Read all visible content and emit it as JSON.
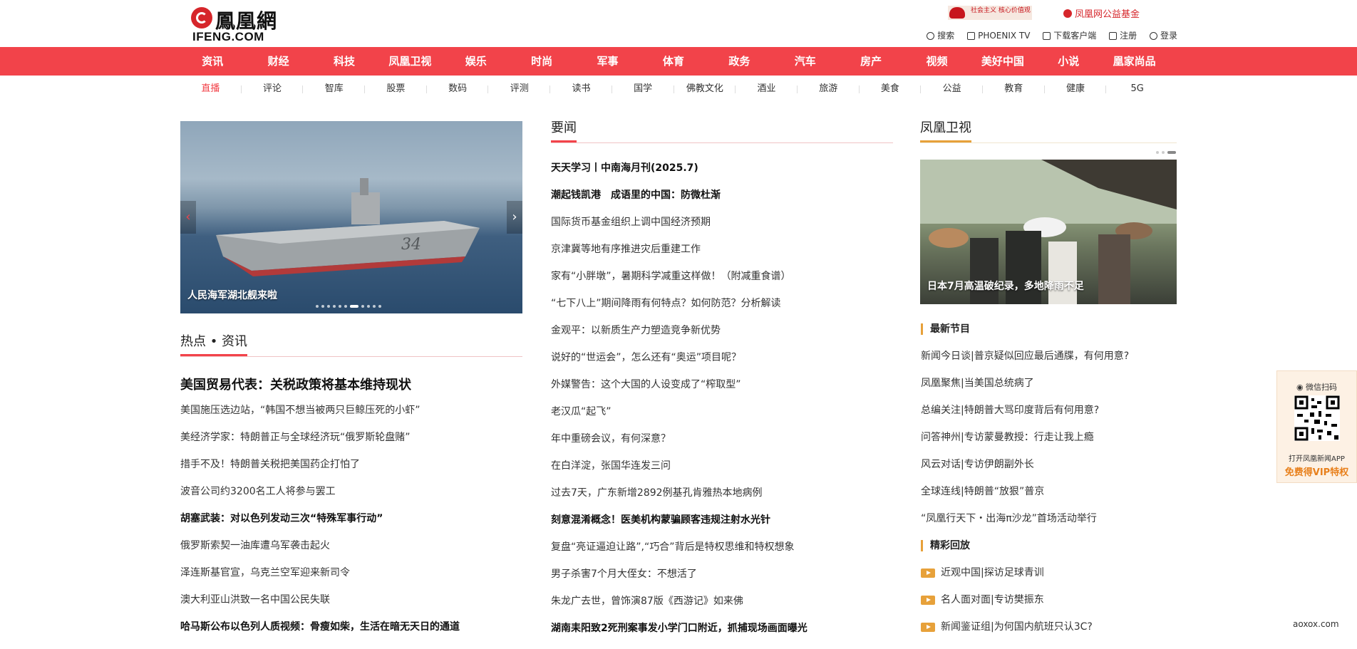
{
  "header": {
    "logo_cn": "鳳凰網",
    "logo_en": "IFENG.COM",
    "promo_left": "社会主义 核心价值观",
    "promo_right": "凤凰网公益基金",
    "top_links": [
      "搜索",
      "PHOENIX TV",
      "下载客户端",
      "注册",
      "登录"
    ]
  },
  "main_nav": [
    "资讯",
    "财经",
    "科技",
    "凤凰卫视",
    "娱乐",
    "时尚",
    "军事",
    "体育",
    "政务",
    "汽车",
    "房产",
    "视频",
    "美好中国",
    "小说",
    "凰家尚品"
  ],
  "sub_nav": [
    "直播",
    "评论",
    "智库",
    "股票",
    "数码",
    "评测",
    "读书",
    "国学",
    "佛教文化",
    "酒业",
    "旅游",
    "美食",
    "公益",
    "教育",
    "健康",
    "5G"
  ],
  "carousel": {
    "caption": "人民海军湖北舰来啦",
    "slide_count": 11,
    "active_index": 6
  },
  "hot": {
    "title": "热点 • 资讯",
    "lead": "美国贸易代表：关税政策将基本维持现状",
    "items": [
      {
        "text": "美国施压选边站，“韩国不想当被两只巨鲸压死的小虾”",
        "bold": false
      },
      {
        "text": "美经济学家：特朗普正与全球经济玩“俄罗斯轮盘赌”",
        "bold": false
      },
      {
        "text": "措手不及！特朗普关税把美国药企打怕了",
        "bold": false
      },
      {
        "text": "波音公司约3200名工人将参与罢工",
        "bold": false
      },
      {
        "text": "胡塞武装：对以色列发动三次“特殊军事行动”",
        "bold": true
      },
      {
        "text": "俄罗斯索契一油库遭乌军袭击起火",
        "bold": false
      },
      {
        "text": "泽连斯基官宣，乌克兰空军迎来新司令",
        "bold": false
      },
      {
        "text": "澳大利亚山洪致一名中国公民失联",
        "bold": false
      },
      {
        "text": "哈马斯公布以色列人质视频：骨瘦如柴，生活在暗无天日的通道",
        "bold": true
      }
    ]
  },
  "news": {
    "title": "要闻",
    "items": [
      {
        "text": "天天学习丨中南海月刊(2025.7)",
        "bold": true
      },
      {
        "text": "潮起钱凯港　成语里的中国：防微杜渐",
        "bold": true
      },
      {
        "text": "国际货币基金组织上调中国经济预期",
        "bold": false
      },
      {
        "text": "京津冀等地有序推进灾后重建工作",
        "bold": false
      },
      {
        "text": "家有“小胖墩”，暑期科学减重这样做！（附减重食谱）",
        "bold": false
      },
      {
        "text": "“七下八上”期间降雨有何特点？如何防范？分析解读",
        "bold": false
      },
      {
        "text": "金观平：以新质生产力塑造竞争新优势",
        "bold": false
      },
      {
        "text": "说好的“世运会”，怎么还有“奥运”项目呢？",
        "bold": false
      },
      {
        "text": "外媒警告：这个大国的人设变成了“榨取型”",
        "bold": false
      },
      {
        "text": "老汉瓜“起飞”",
        "bold": false
      },
      {
        "text": "年中重磅会议，有何深意？",
        "bold": false
      },
      {
        "text": "在白洋淀，张国华连发三问",
        "bold": false
      },
      {
        "text": "过去7天，广东新增2892例基孔肯雅热本地病例",
        "bold": false
      },
      {
        "text": "刻意混淆概念！医美机构蒙骗顾客违规注射水光针",
        "bold": true
      },
      {
        "text": "复盘“亮证逼迫让路”,“巧合”背后是特权思维和特权想象",
        "bold": false
      },
      {
        "text": "男子杀害7个月大侄女：不想活了",
        "bold": false
      },
      {
        "text": "朱龙广去世，曾饰演87版《西游记》如来佛",
        "bold": false
      },
      {
        "text": "湖南耒阳致2死刑案事发小学门口附近，抓捕现场画面曝光",
        "bold": true
      }
    ]
  },
  "tv": {
    "title": "凤凰卫视",
    "image_caption": "日本7月高温破纪录，多地降雨不足",
    "latest_title": "最新节目",
    "latest": [
      "新闻今日谈|普京疑似回应最后通牒，有何用意?",
      "凤凰聚焦|当美国总统病了",
      "总编关注|特朗普大骂印度背后有何用意?",
      "问答神州|专访蒙曼教授：行走让我上瘾",
      "风云对话|专访伊朗副外长",
      "全球连线|特朗普“放狠”普京",
      "“凤凰行天下・出海π沙龙”首场活动举行"
    ],
    "replay_title": "精彩回放",
    "replay": [
      "近观中国|探访足球青训",
      "名人面对面|专访樊振东",
      "新闻鉴证组|为何国内航班只认3C?"
    ]
  },
  "float_qr": {
    "title": "微信扫码",
    "line1": "打开凤凰新闻APP",
    "line2": "免费得VIP特权"
  },
  "watermark": "aoxox.com",
  "colors": {
    "brand_red": "#f2434a",
    "gold": "#e7a13a",
    "orange": "#e8801c"
  }
}
